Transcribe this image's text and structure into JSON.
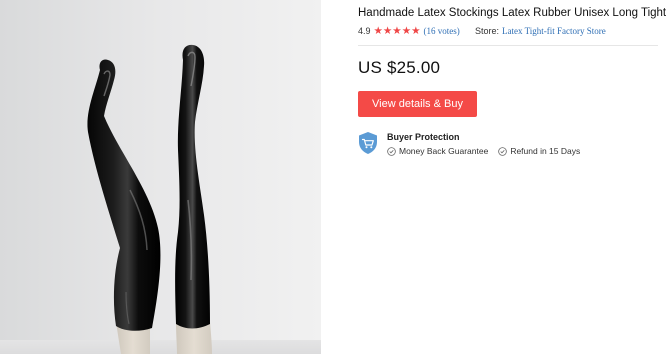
{
  "product": {
    "title": "Handmade Latex Stockings Latex Rubber Unisex Long Tight Socks",
    "rating": "4.9",
    "stars_filled": 5,
    "votes": "(16 votes)",
    "store_label": "Store:",
    "store_name": "Latex Tight-fit Factory Store",
    "price": "US $25.00",
    "buy_button_label": "View details & Buy"
  },
  "protection": {
    "title": "Buyer Protection",
    "items": [
      "Money Back Guarantee",
      "Refund in 15 Days"
    ]
  },
  "colors": {
    "accent": "#f44a47",
    "star": "#ef4646",
    "link": "#2f6fb5",
    "shield": "#5b9bd5"
  },
  "icons": [
    "star-icon",
    "shield-cart-icon",
    "check-circle-icon"
  ]
}
